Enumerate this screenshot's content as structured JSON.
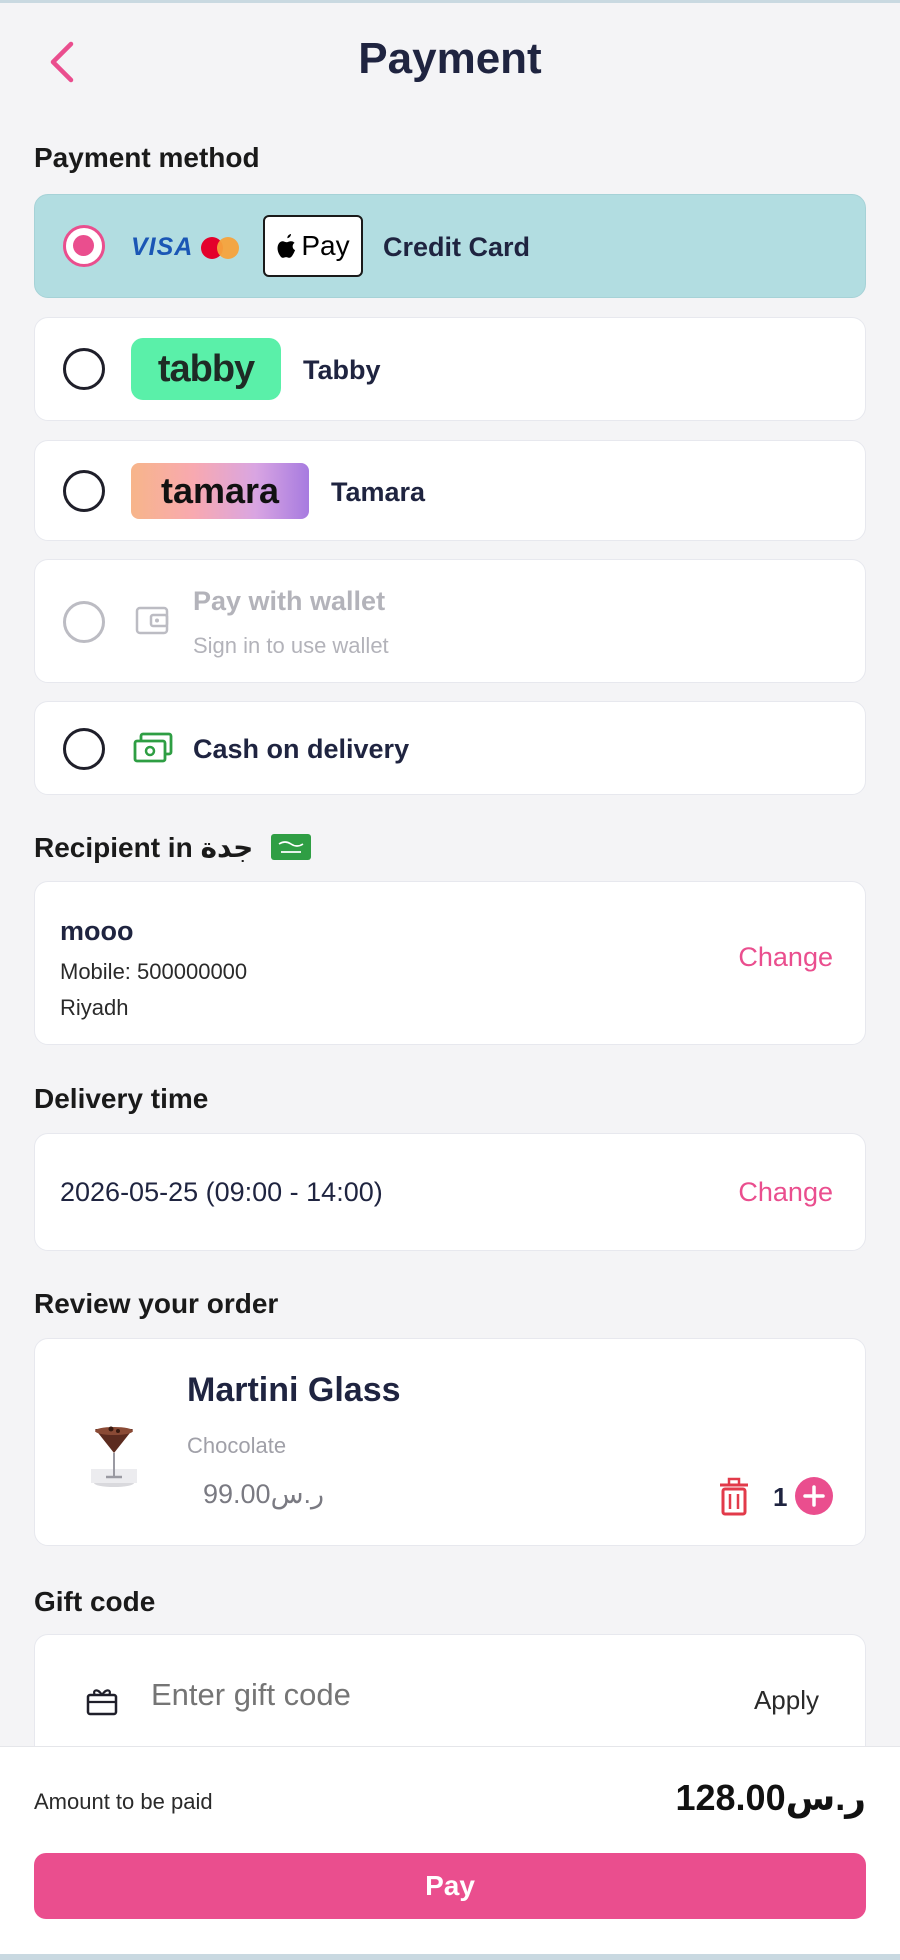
{
  "header": {
    "title": "Payment"
  },
  "payment_method": {
    "section_title": "Payment method",
    "options": [
      {
        "label": "Credit Card",
        "selected": true,
        "brands": [
          "VISA",
          "Mastercard",
          "Pay"
        ]
      },
      {
        "label": "Tabby",
        "selected": false,
        "logo_text": "tabby"
      },
      {
        "label": "Tamara",
        "selected": false,
        "logo_text": "tamara"
      },
      {
        "label": "Pay with wallet",
        "sublabel": "Sign in to use wallet",
        "selected": false,
        "disabled": true
      },
      {
        "label": "Cash on delivery",
        "selected": false
      }
    ]
  },
  "recipient": {
    "section_title": "Recipient in جدة",
    "name": "mooo",
    "mobile": "Mobile: 500000000",
    "city": "Riyadh",
    "change_label": "Change"
  },
  "delivery": {
    "section_title": "Delivery time",
    "value": "2026-05-25 (09:00 - 14:00)",
    "change_label": "Change"
  },
  "order": {
    "section_title": "Review your order",
    "items": [
      {
        "name": "Martini Glass",
        "variant": "Chocolate",
        "price": "ر.س99.00",
        "quantity": "1"
      }
    ]
  },
  "gift": {
    "section_title": "Gift code",
    "placeholder": "Enter gift code",
    "apply_label": "Apply"
  },
  "footer": {
    "amount_label": "Amount to be paid",
    "amount": "ر.س128.00",
    "pay_label": "Pay"
  },
  "colors": {
    "accent": "#ea4e8e",
    "selected_bg": "#b2dde1",
    "text_dark": "#1f2440",
    "wallet_icon": "#bcbcc3",
    "cash_icon": "#2e9e43"
  },
  "icons": [
    "chevron-left-icon",
    "apple-icon",
    "wallet-icon",
    "cash-icon",
    "flag-icon",
    "trash-icon",
    "plus-icon",
    "gift-icon"
  ]
}
